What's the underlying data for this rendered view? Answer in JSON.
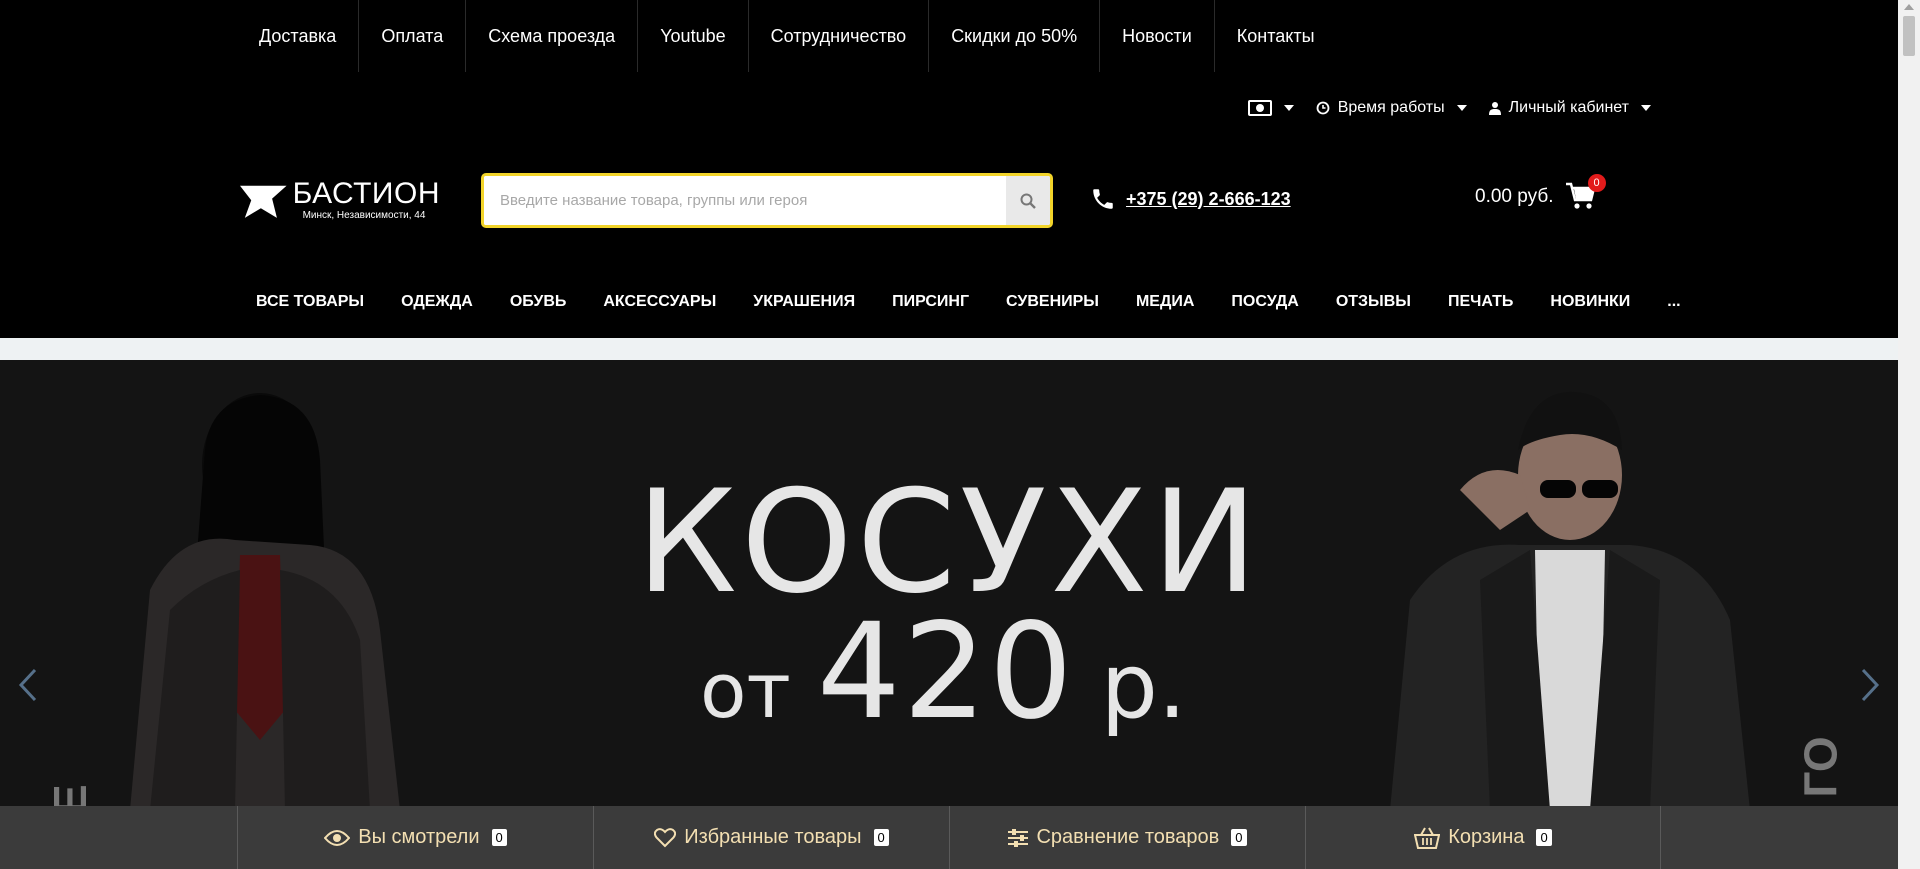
{
  "toplinks": [
    "Доставка",
    "Оплата",
    "Схема проезда",
    "Youtube",
    "Сотрудничество",
    "Скидки до 50%",
    "Новости",
    "Контакты"
  ],
  "utility": {
    "currency_icon": "cash-icon",
    "hours_label": "Время работы",
    "account_label": "Личный кабинет"
  },
  "logo": {
    "title": "БАСТИОН",
    "subtitle": "Минск, Независимости, 44"
  },
  "search": {
    "placeholder": "Введите название товара, группы или героя",
    "accent_color": "#f2d42a"
  },
  "phone": "+375 (29) 2-666-123",
  "cart": {
    "total": "0.00 руб.",
    "count": "0",
    "badge_color": "#e21b1b"
  },
  "categories": [
    "ВСЕ ТОВАРЫ",
    "ОДЕЖДА",
    "ОБУВЬ",
    "АКСЕССУАРЫ",
    "УКРАШЕНИЯ",
    "ПИРСИНГ",
    "СУВЕНИРЫ",
    "МЕДИА",
    "ПОСУДА",
    "ОТЗЫВЫ",
    "ПЕЧАТЬ",
    "НОВИНКИ",
    "..."
  ],
  "banner": {
    "title": "КОСУХИ",
    "price_prefix": "от",
    "price_value": "420",
    "price_currency": "р.",
    "side_left": "Е",
    "side_right": "ГО"
  },
  "bottombar": [
    {
      "label": "Вы смотрели",
      "count": "0",
      "icon": "eye-icon"
    },
    {
      "label": "Избранные товары",
      "count": "0",
      "icon": "heart-icon"
    },
    {
      "label": "Сравнение товаров",
      "count": "0",
      "icon": "sliders-icon"
    },
    {
      "label": "Корзина",
      "count": "0",
      "icon": "basket-icon"
    }
  ],
  "colors": {
    "background": "#000000",
    "bottombar_text": "#f3dfb2",
    "bottombar_bg": "#3b3b3b"
  }
}
